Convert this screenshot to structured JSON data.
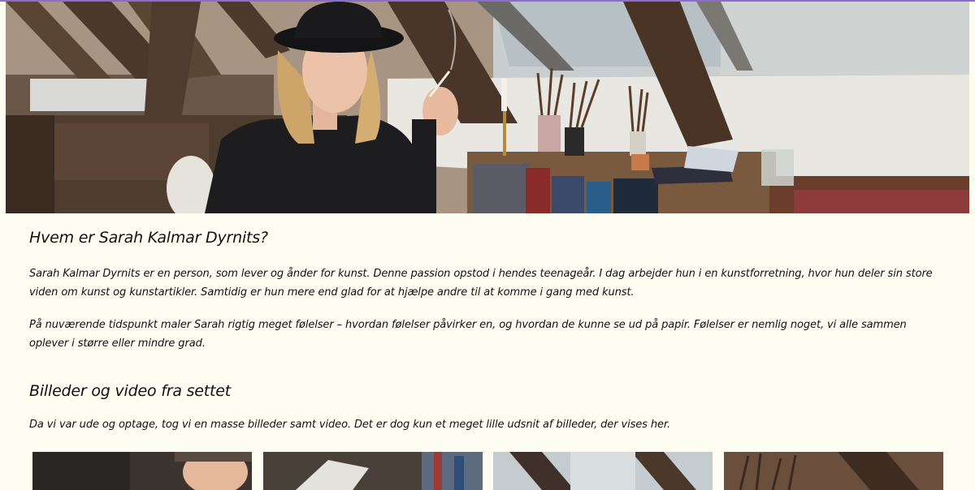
{
  "hero": {
    "alt_icon": "hero-photo-icon"
  },
  "about": {
    "heading": "Hvem er Sarah Kalmar Dyrnits?",
    "paragraph_1": "Sarah Kalmar Dyrnits er en person, som lever og ånder for kunst. Denne passion opstod i hendes teenageår. I dag arbejder hun i en kunstforretning, hvor hun deler sin store viden om kunst og kunstartikler. Samtidig er hun mere end glad for at hjælpe andre til at komme i gang med kunst.",
    "paragraph_2": "På nuværende tidspunkt maler Sarah rigtig meget følelser – hvordan følelser påvirker en, og hvordan de kunne se ud på papir. Følelser er nemlig noget, vi alle sammen oplever i større eller mindre grad."
  },
  "gallery": {
    "heading": "Billeder og video fra settet",
    "intro": "Da vi var ude og optage, tog vi en masse billeder samt video. Det er dog kun et meget lille udsnit af billeder, der vises her.",
    "thumbnails": [
      {
        "icon": "photo-icon"
      },
      {
        "icon": "photo-icon"
      },
      {
        "icon": "photo-icon"
      },
      {
        "icon": "photo-icon"
      }
    ]
  },
  "colors": {
    "background": "#fefdf2",
    "accent_top_border": "#8d6bd0",
    "text": "#111111"
  }
}
